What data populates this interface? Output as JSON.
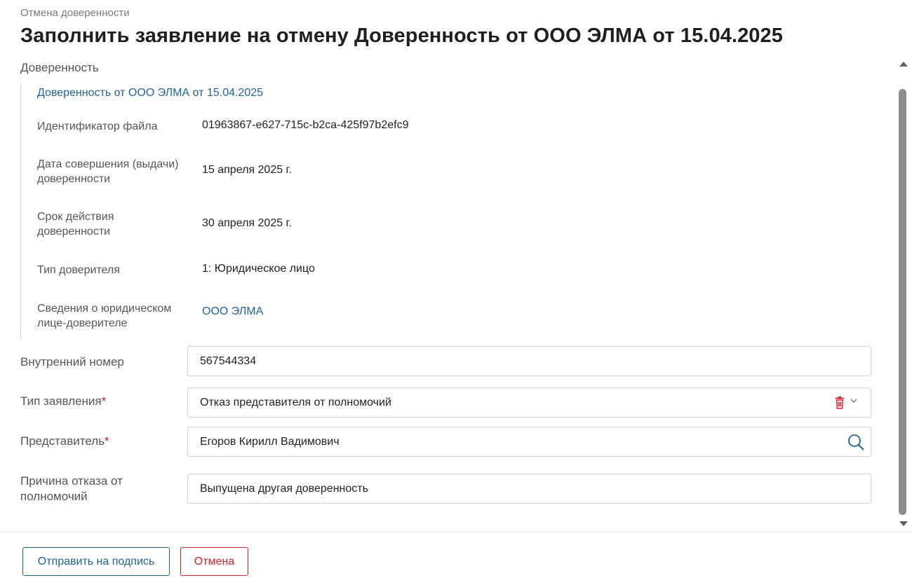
{
  "breadcrumb": "Отмена доверенности",
  "title": "Заполнить заявление на отмену Доверенность от ООО ЭЛМА от 15.04.2025",
  "section_label": "Доверенность",
  "attorney": {
    "link": "Доверенность от ООО ЭЛМА от 15.04.2025",
    "rows": [
      {
        "label": "Идентификатор файла",
        "value": "01963867-e627-715c-b2ca-425f97b2efc9"
      },
      {
        "label": "Дата совершения (выдачи) доверенности",
        "value": "15 апреля 2025 г."
      },
      {
        "label": "Срок действия доверенности",
        "value": "30 апреля 2025 г."
      },
      {
        "label": "Тип доверителя",
        "value": "1: Юридическое лицо"
      },
      {
        "label": "Сведения о юридическом лице-доверителе",
        "value": "ООО ЭЛМА"
      }
    ]
  },
  "form": {
    "internal_number": {
      "label": "Внутренний номер",
      "value": "567544334"
    },
    "application_type": {
      "label": "Тип заявления",
      "required_mark": "*",
      "value": "Отказ представителя от полномочий"
    },
    "representative": {
      "label": "Представитель",
      "required_mark": "*",
      "value": "Егоров Кирилл Вадимович"
    },
    "refusal_reason": {
      "label": "Причина отказа от полномочий",
      "value": "Выпущена другая доверенность"
    }
  },
  "buttons": {
    "submit": "Отправить на подпись",
    "cancel": "Отмена"
  },
  "colors": {
    "accent": "#1f6490",
    "danger": "#d0202a"
  },
  "icons": [
    "trash-icon",
    "chevron-down-icon",
    "search-icon",
    "scroll-up-arrow",
    "scroll-down-arrow"
  ]
}
